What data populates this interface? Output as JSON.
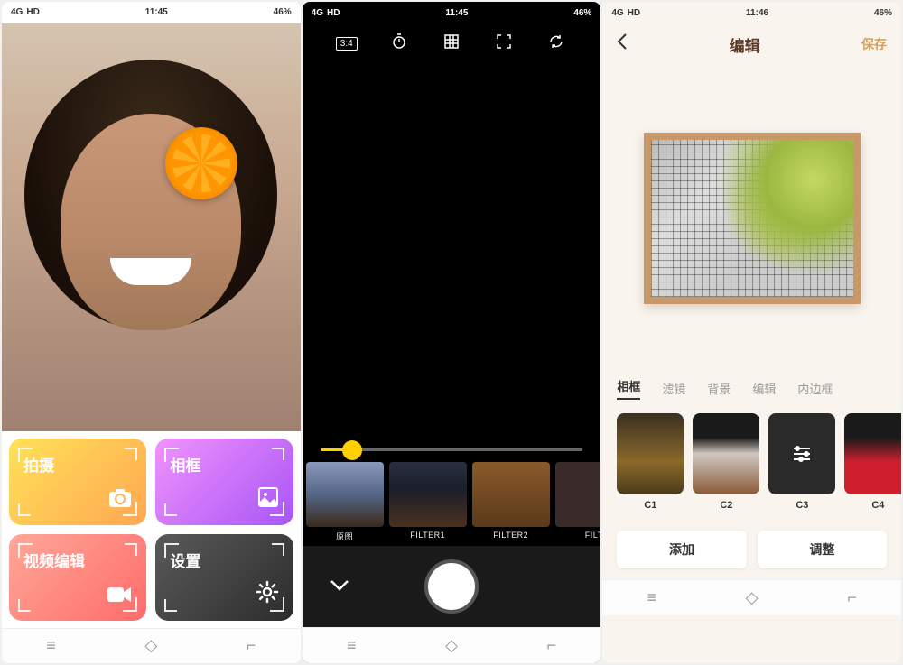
{
  "status": {
    "time1": "11:45",
    "time2": "11:45",
    "time3": "11:46",
    "battery": "46%",
    "signal": "4G",
    "hd": "HD"
  },
  "screen1": {
    "cards": {
      "shoot": "拍摄",
      "frame": "相框",
      "video": "视频编辑",
      "settings": "设置"
    }
  },
  "screen2": {
    "filters": [
      {
        "label": "原图"
      },
      {
        "label": "FILTER1"
      },
      {
        "label": "FILTER2"
      },
      {
        "label": "FILT"
      }
    ],
    "aspect": "3:4"
  },
  "screen3": {
    "title": "编辑",
    "save": "保存",
    "tabs": [
      "相框",
      "滤镜",
      "背景",
      "编辑",
      "内边框"
    ],
    "frames": [
      {
        "label": "C1"
      },
      {
        "label": "C2"
      },
      {
        "label": "C3"
      },
      {
        "label": "C4"
      }
    ],
    "buttons": {
      "add": "添加",
      "adjust": "调整"
    }
  }
}
